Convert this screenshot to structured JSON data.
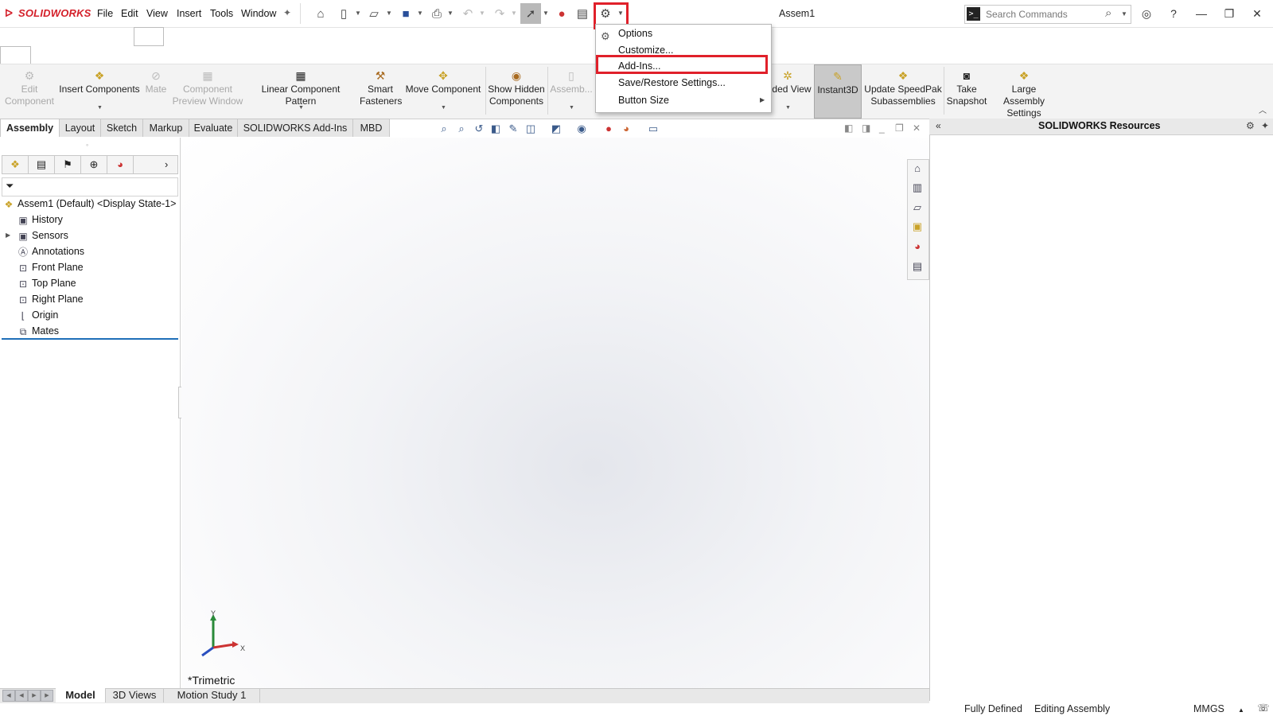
{
  "app": {
    "logo": "SOLIDWORKS",
    "document_title": "Assem1"
  },
  "menu": [
    "File",
    "Edit",
    "View",
    "Insert",
    "Tools",
    "Window"
  ],
  "search": {
    "placeholder": "Search Commands"
  },
  "dropdown": {
    "items": [
      "Options",
      "Customize...",
      "Add-Ins...",
      "Save/Restore Settings...",
      "Button Size"
    ],
    "highlighted": "Add-Ins..."
  },
  "command_manager": {
    "commands": [
      {
        "label1": "Edit",
        "label2": "Component",
        "enabled": false
      },
      {
        "label1": "Insert Components",
        "label2": "",
        "enabled": true
      },
      {
        "label1": "Mate",
        "label2": "",
        "enabled": false
      },
      {
        "label1": "Component",
        "label2": "Preview Window",
        "enabled": false
      },
      {
        "label1": "Linear Component Pattern",
        "label2": "",
        "enabled": true
      },
      {
        "label1": "Smart",
        "label2": "Fasteners",
        "enabled": true
      },
      {
        "label1": "Move Component",
        "label2": "",
        "enabled": true
      },
      {
        "label1": "Show Hidden",
        "label2": "Components",
        "enabled": true
      },
      {
        "label1": "Assemb...",
        "label2": "",
        "enabled": false
      },
      {
        "label1": "...ded View",
        "label2": "",
        "enabled": true
      },
      {
        "label1": "Instant3D",
        "label2": "",
        "enabled": true,
        "active": true
      },
      {
        "label1": "Update SpeedPak",
        "label2": "Subassemblies",
        "enabled": true
      },
      {
        "label1": "Take",
        "label2": "Snapshot",
        "enabled": true
      },
      {
        "label1": "Large Assembly",
        "label2": "Settings",
        "enabled": true
      }
    ]
  },
  "tabs": [
    "Assembly",
    "Layout",
    "Sketch",
    "Markup",
    "Evaluate",
    "SOLIDWORKS Add-Ins",
    "MBD"
  ],
  "selected_tab": "Assembly",
  "feature_tree": {
    "root": "Assem1 (Default) <Display State-1>",
    "items": [
      "History",
      "Sensors",
      "Annotations",
      "Front Plane",
      "Top Plane",
      "Right Plane",
      "Origin",
      "Mates"
    ]
  },
  "viewport": {
    "view_label": "*Trimetric",
    "axes": {
      "x": "X",
      "y": "Y"
    }
  },
  "bottom_tabs": [
    "Model",
    "3D Views",
    "Motion Study 1"
  ],
  "selected_bottom_tab": "Model",
  "resources_panel": {
    "title": "SOLIDWORKS Resources"
  },
  "status_bar": {
    "state": "Fully Defined",
    "mode": "Editing Assembly",
    "units": "MMGS"
  },
  "colors": {
    "highlight": "#e0202a",
    "brand": "#d4202a",
    "tree_selection_line": "#1f6fb8"
  }
}
